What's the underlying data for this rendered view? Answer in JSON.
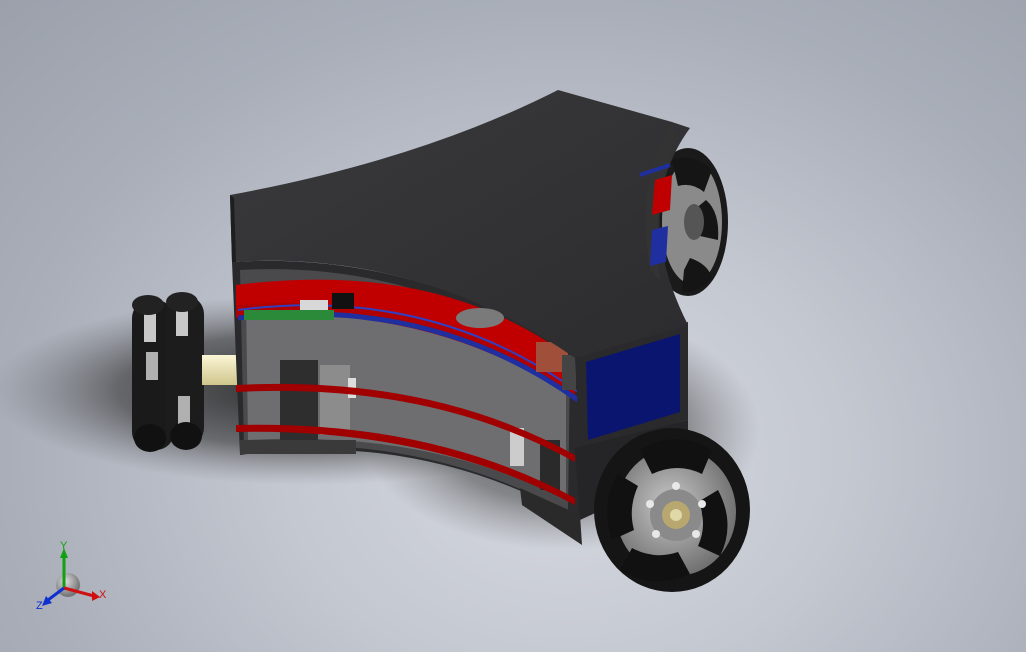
{
  "viewport": {
    "background_top": "#9ba0ab",
    "background_bottom": "#d6d9e0"
  },
  "model": {
    "body_color": "#3c3c3e",
    "shelf_color": "#b00000",
    "cable_color": "#1f2fa0",
    "panel_color": "#0a1570",
    "wheel_roller_color": "#141414",
    "wheel_hub_color": "#9a9a9a",
    "motor_color": "#e8e0b0"
  },
  "triad": {
    "x_label": "X",
    "y_label": "Y",
    "z_label": "Z",
    "x_color": "#d01010",
    "y_color": "#10a010",
    "z_color": "#1030d0"
  }
}
